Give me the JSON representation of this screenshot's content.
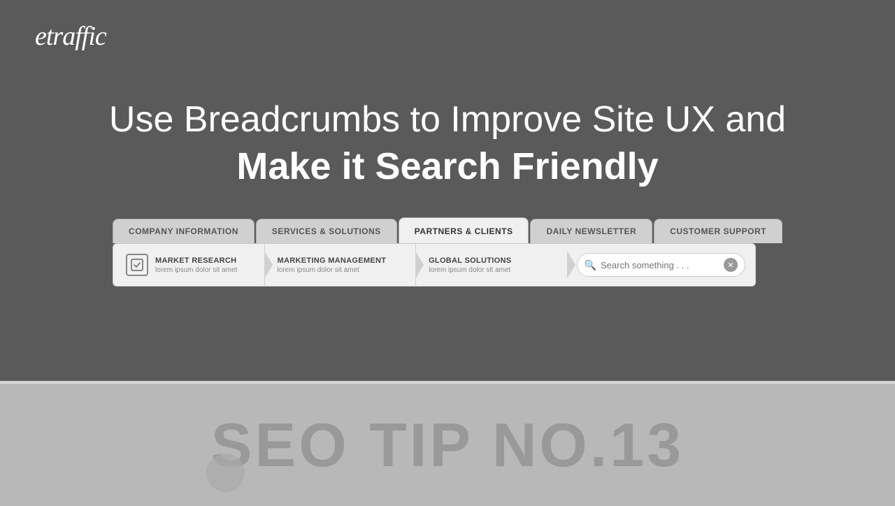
{
  "logo": {
    "text": "etraffic"
  },
  "headline": {
    "line1": "Use Breadcrumbs to Improve Site UX and",
    "line2": "Make it Search Friendly"
  },
  "tabs": [
    {
      "id": "company-information",
      "label": "COMPANY INFORMATION",
      "active": false
    },
    {
      "id": "services-solutions",
      "label": "SERVICES & SOLUTIONS",
      "active": false
    },
    {
      "id": "partners-clients",
      "label": "PARTNERS & CLIENTS",
      "active": true
    },
    {
      "id": "daily-newsletter",
      "label": "DAILY NEWSLETTER",
      "active": false
    },
    {
      "id": "customer-support",
      "label": "CUSTOMER SUPPORT",
      "active": false
    }
  ],
  "breadcrumbs": [
    {
      "id": "market-research",
      "title": "MARKET RESEARCH",
      "subtitle": "lorem ipsum dolor sit amet",
      "hasIcon": true
    },
    {
      "id": "marketing-management",
      "title": "MARKETING MANAGEMENT",
      "subtitle": "lorem ipsum dolor sit amet",
      "hasIcon": false
    },
    {
      "id": "global-solutions",
      "title": "GLOBAL SOLUTIONS",
      "subtitle": "lorem ipsum dolor sit amet",
      "hasIcon": false
    }
  ],
  "search": {
    "placeholder": "Search something . . ."
  },
  "seo_tip": {
    "text": "SEO TIP NO.13"
  }
}
